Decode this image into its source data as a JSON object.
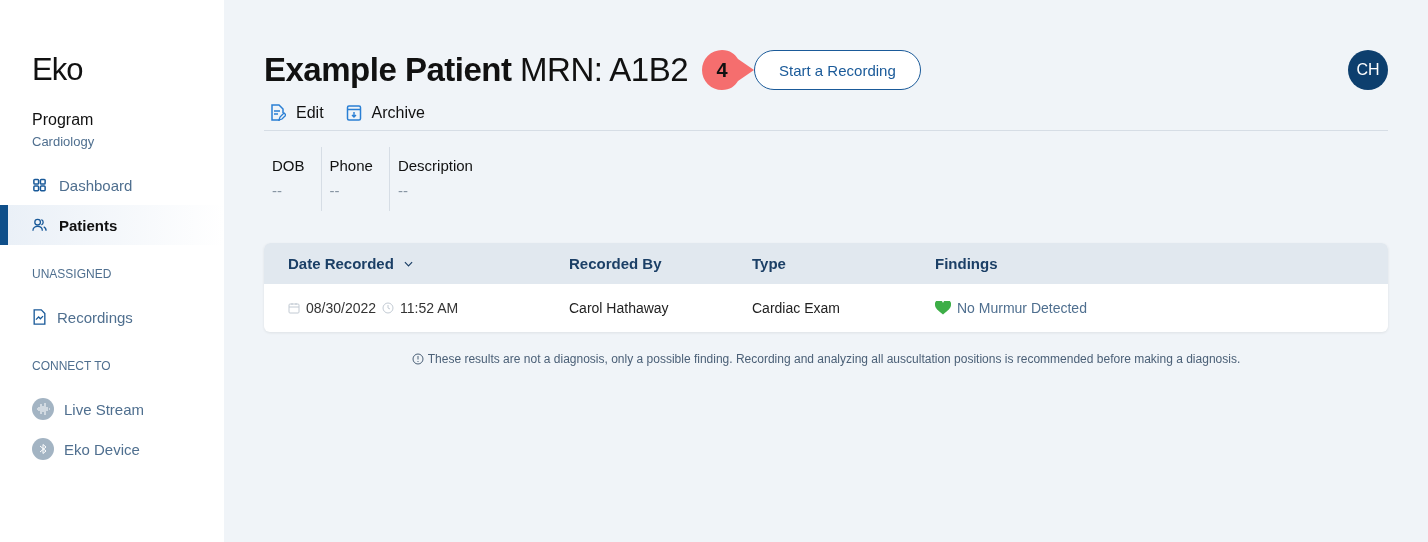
{
  "sidebar": {
    "logo": "Eko",
    "program_label": "Program",
    "program_name": "Cardiology",
    "nav": [
      {
        "label": "Dashboard",
        "kind": "grid",
        "selected": false
      },
      {
        "label": "Patients",
        "kind": "people",
        "selected": true
      }
    ],
    "sections": [
      {
        "title": "UNASSIGNED",
        "items": [
          {
            "label": "Recordings",
            "kind": "file"
          }
        ]
      },
      {
        "title": "CONNECT TO",
        "items": [
          {
            "label": "Live Stream",
            "kind": "wave"
          },
          {
            "label": "Eko Device",
            "kind": "bluetooth"
          }
        ]
      }
    ]
  },
  "header": {
    "name": "Example Patient",
    "mrn": "MRN: A1B2",
    "step_marker": "4",
    "button": "Start a Recording",
    "avatar": "CH"
  },
  "actions": [
    {
      "label": "Edit",
      "kind": "edit"
    },
    {
      "label": "Archive",
      "kind": "archive"
    }
  ],
  "fields": [
    {
      "label": "DOB",
      "value": "--"
    },
    {
      "label": "Phone",
      "value": "--"
    },
    {
      "label": "Description",
      "value": "--"
    }
  ],
  "table": {
    "columns": [
      "Date Recorded",
      "Recorded By",
      "Type",
      "Findings"
    ],
    "rows": [
      {
        "date": "08/30/2022",
        "time": "11:52 AM",
        "recorded_by": "Carol Hathaway",
        "type": "Cardiac Exam",
        "finding": "No Murmur Detected",
        "color": "#3dae47"
      }
    ]
  },
  "disclaimer": "These results are not a diagnosis, only a possible finding. Recording and analyzing all auscultation positions is recommended before making a diagnosis."
}
